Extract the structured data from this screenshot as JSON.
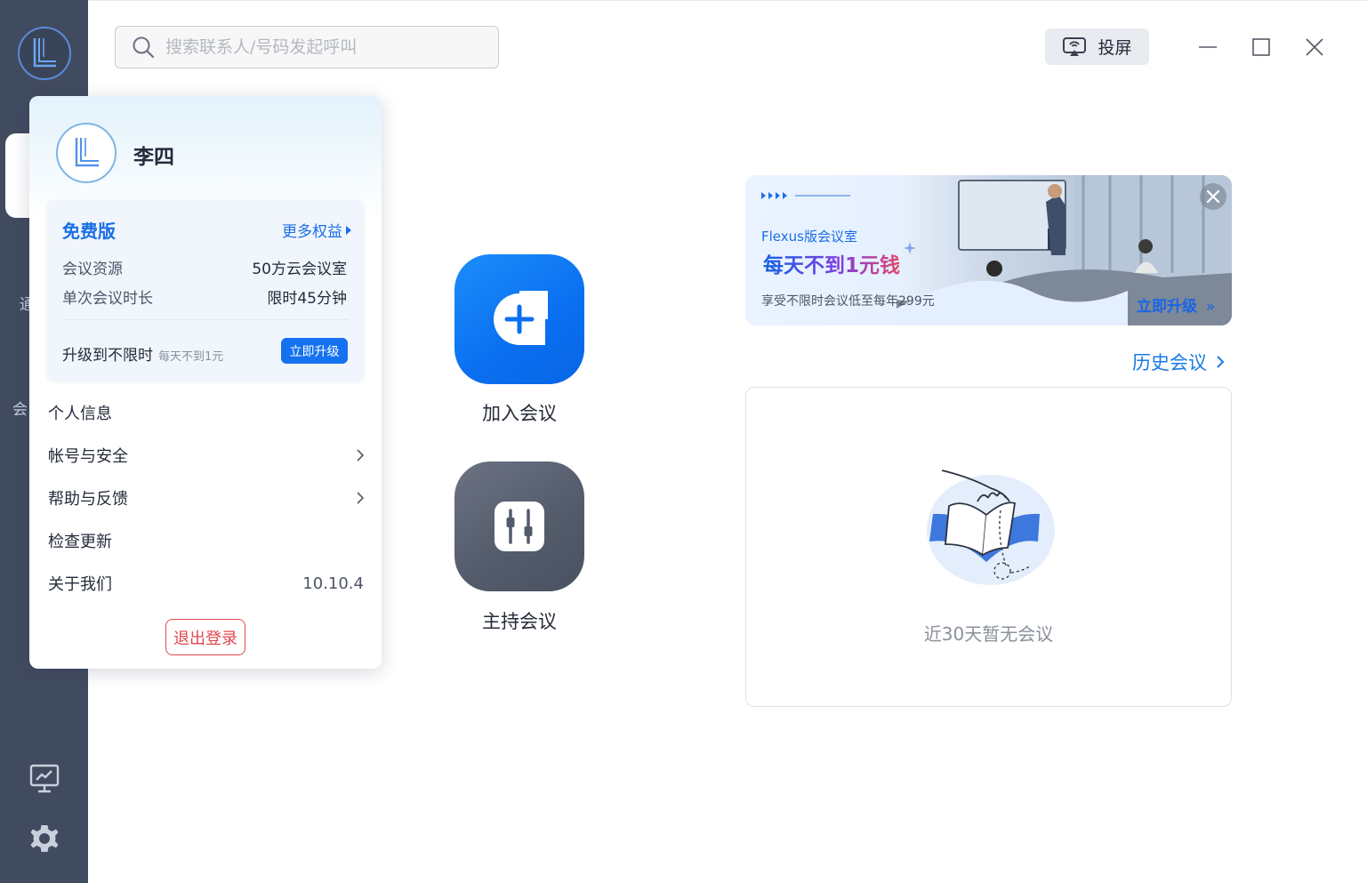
{
  "search": {
    "placeholder": "搜索联系人/号码发起呼叫"
  },
  "toolbar": {
    "cast_label": "投屏"
  },
  "rail": {
    "label_1": "通",
    "label_2": "会"
  },
  "actions": {
    "join_label": "加入会议",
    "host_label": "主持会议"
  },
  "banner": {
    "line1": "Flexus版会议室",
    "line2": "每天不到1元钱",
    "line3": "享受不限时会议低至每年299元",
    "cta": "立即升级"
  },
  "history": {
    "link_label": "历史会议",
    "empty_text": "近30天暂无会议"
  },
  "profile": {
    "name": "李四",
    "plan": {
      "title": "免费版",
      "more_label": "更多权益",
      "rows": [
        {
          "label": "会议资源",
          "value": "50方云会议室"
        },
        {
          "label": "单次会议时长",
          "value": "限时45分钟"
        }
      ],
      "upgrade_text": "升级到不限时",
      "upgrade_sub": "每天不到1元",
      "upgrade_button": "立即升级"
    },
    "menu": [
      {
        "label": "个人信息",
        "value": "",
        "has_arrow": false
      },
      {
        "label": "帐号与安全",
        "value": "",
        "has_arrow": true
      },
      {
        "label": "帮助与反馈",
        "value": "",
        "has_arrow": true
      },
      {
        "label": "检查更新",
        "value": "",
        "has_arrow": false
      },
      {
        "label": "关于我们",
        "value": "10.10.4",
        "has_arrow": false
      }
    ],
    "logout_label": "退出登录"
  },
  "colors": {
    "accent": "#1a7ae6",
    "rail": "#414b60",
    "danger": "#e0474c",
    "tile_join": "#0a6ff0",
    "tile_host": "#535b6b"
  }
}
